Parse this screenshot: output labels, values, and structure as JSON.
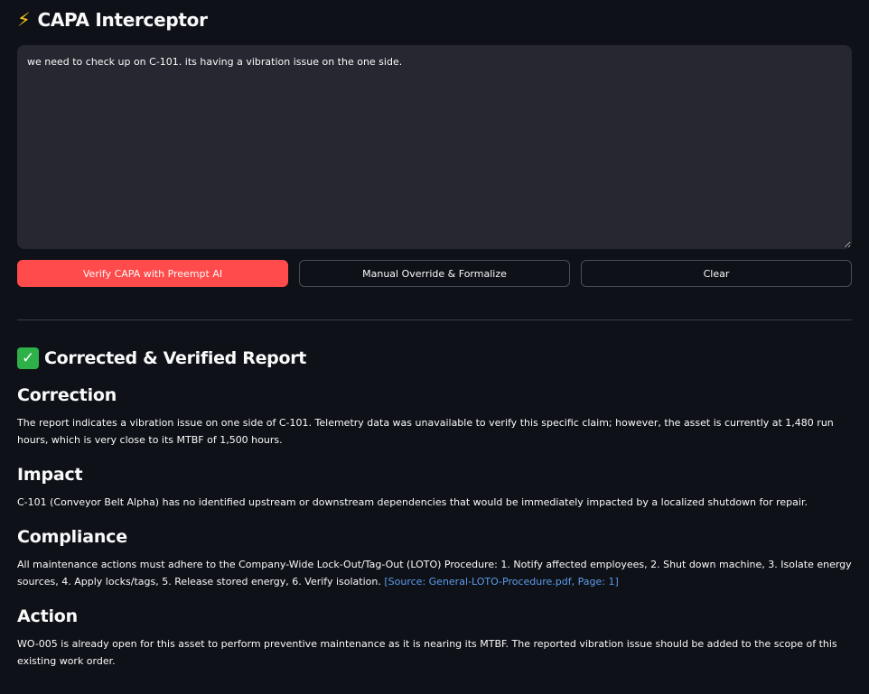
{
  "app": {
    "title": "CAPA Interceptor",
    "title_icon": "lightning-bolt-icon"
  },
  "input": {
    "value": "we need to check up on C-101. its having a vibration issue on the one side."
  },
  "buttons": {
    "verify": "Verify CAPA with Preempt AI",
    "override": "Manual Override & Formalize",
    "clear": "Clear"
  },
  "colors": {
    "primary": "#ff4b4b",
    "background": "#0e1117",
    "input_bg": "#262730",
    "link": "#5d9cec"
  },
  "report": {
    "title": "Corrected & Verified Report",
    "title_icon": "check-mark-icon",
    "correction": {
      "heading": "Correction",
      "body": "The report indicates a vibration issue on one side of C-101. Telemetry data was unavailable to verify this specific claim; however, the asset is currently at 1,480 run hours, which is very close to its MTBF of 1,500 hours."
    },
    "impact": {
      "heading": "Impact",
      "body": "C-101 (Conveyor Belt Alpha) has no identified upstream or downstream dependencies that would be immediately impacted by a localized shutdown for repair."
    },
    "compliance": {
      "heading": "Compliance",
      "body": "All maintenance actions must adhere to the Company-Wide Lock-Out/Tag-Out (LOTO) Procedure: 1. Notify affected employees, 2. Shut down machine, 3. Isolate energy sources, 4. Apply locks/tags, 5. Release stored energy, 6. Verify isolation.",
      "source": "[Source: General-LOTO-Procedure.pdf, Page: 1]"
    },
    "action": {
      "heading": "Action",
      "body": "WO-005 is already open for this asset to perform preventive maintenance as it is nearing its MTBF. The reported vibration issue should be added to the scope of this existing work order."
    }
  }
}
